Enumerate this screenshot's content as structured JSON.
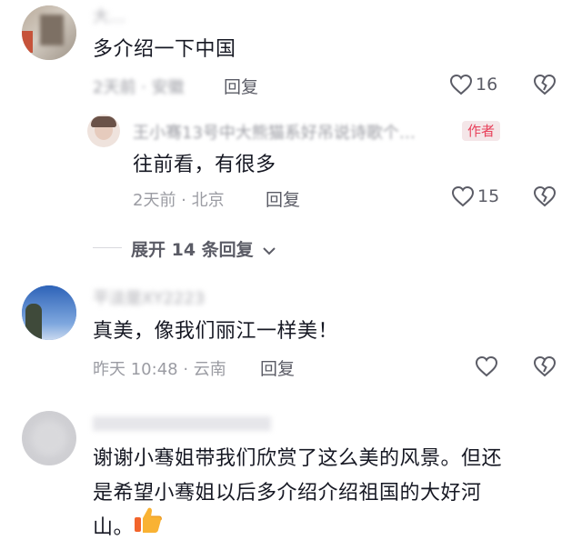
{
  "comments": [
    {
      "username": "大…",
      "text": "多介绍一下中国",
      "meta": "2天前 · 安徽",
      "reply_label": "回复",
      "likes": "16",
      "replies": [
        {
          "username": "王小骞13号中大熊猫系好吊说诗歌个…",
          "author_tag": "作者",
          "text": "往前看，有很多",
          "meta": "2天前 · 北京",
          "reply_label": "回复",
          "likes": "15"
        }
      ],
      "expand_label": "展开 14 条回复"
    },
    {
      "username": "平淡是XY2223",
      "text": "真美，像我们丽江一样美！",
      "meta": "昨天 10:48 · 云南",
      "reply_label": "回复"
    },
    {
      "username": "",
      "text_line1": "谢谢小骞姐带我们欣赏了这么美的风景。但还",
      "text_line2": "是希望小骞姐以后多介绍介绍祖国的大好河",
      "text_line3": "山。",
      "emoji": "thumbs-up"
    }
  ],
  "colors": {
    "author_tag_bg": "#f4e6e8",
    "author_tag_text": "#e8415b",
    "meta_text": "#9b9ca3"
  }
}
